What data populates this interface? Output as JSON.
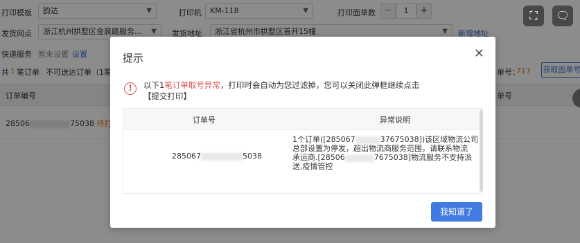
{
  "form": {
    "template_label": "打印模板",
    "template_value": "韵达",
    "printer_label": "打印机",
    "printer_value": "KM-118",
    "copies_label": "打印面单数",
    "copies_value": "1",
    "outlet_label": "发货网点",
    "outlet_value": "浙江杭州拱墅区金晨路服务...",
    "address_label": "发货地址",
    "address_value": "浙江省杭州市拱墅区首开15幢",
    "new_address_link": "新增地址",
    "express_label": "快递服务",
    "express_status": "暂未设置",
    "express_setting_link": "设置"
  },
  "summary": {
    "prefix": "共",
    "count": "1",
    "suffix": "笔订单",
    "not_deliverable": "不可送达订单（1笔",
    "waybill_label": "单号：",
    "waybill_count": "717",
    "fetch_button": "获取面单号"
  },
  "table": {
    "col_order": "订单编号",
    "col_waybill": "单号",
    "row_order_start": "28506",
    "row_order_end": "75038",
    "row_tag": "待打"
  },
  "dialog": {
    "title": "提示",
    "message_prefix": "以下1",
    "message_highlight": "笔订单取号异常",
    "message_rest": "，打印时会自动为您过滤掉，您可以关闭此弹框继续点击",
    "message_action": "【提交打印】",
    "col_order": "订单号",
    "col_reason": "异常说明",
    "row_order_start": "285067",
    "row_order_end": "5038",
    "reason_lines": [
      "1个订单([285067",
      "37675038])该区域物流公司",
      "总部设置为停发，超出物流商服务范围，请联系物流",
      "承运商.[28506",
      "7675038]物流服务不支持派",
      "送,疫情管控"
    ],
    "ok_button": "我知道了"
  },
  "colors": {
    "accent": "#3f7be0",
    "warning": "#d9534f",
    "highlight": "#e77a1b"
  }
}
